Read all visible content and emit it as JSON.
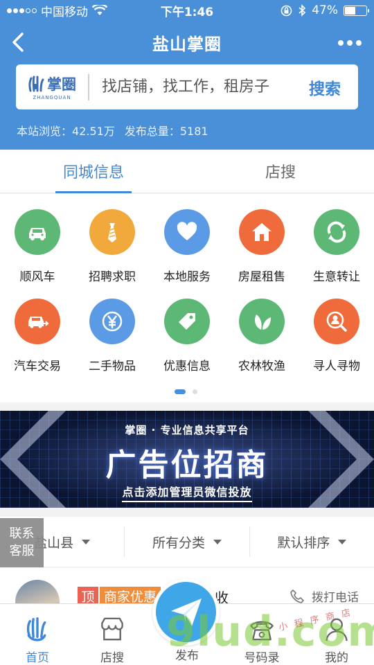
{
  "status_bar": {
    "carrier": "中国移动",
    "time": "下午1:46",
    "battery": "47%",
    "battery_level": 0.47
  },
  "header": {
    "title": "盐山掌圈",
    "logo_text": "掌圈",
    "logo_subtext": "ZHANGQUAN",
    "search_placeholder": "找店铺，找工作，租房子",
    "search_button": "搜索",
    "stats_views_label": "本站浏览：",
    "stats_views": "42.51万",
    "stats_posts_label": "发布总量：",
    "stats_posts": "5181"
  },
  "tabs": [
    {
      "label": "同城信息",
      "active": true
    },
    {
      "label": "店搜",
      "active": false
    }
  ],
  "categories": [
    {
      "label": "顺风车",
      "icon": "car-icon",
      "color": "#5cb874"
    },
    {
      "label": "招聘求职",
      "icon": "tie-icon",
      "color": "#f2a93b"
    },
    {
      "label": "本地服务",
      "icon": "heart-icon",
      "color": "#5b9be6"
    },
    {
      "label": "房屋租售",
      "icon": "house-icon",
      "color": "#ef6b3c"
    },
    {
      "label": "生意转让",
      "icon": "transfer-icon",
      "color": "#5cb874"
    },
    {
      "label": "汽车交易",
      "icon": "car-trade-icon",
      "color": "#ef6b3c"
    },
    {
      "label": "二手物品",
      "icon": "yuan-icon",
      "color": "#5b9be6"
    },
    {
      "label": "优惠信息",
      "icon": "price-tag-icon",
      "color": "#5cb874"
    },
    {
      "label": "农林牧渔",
      "icon": "leaf-icon",
      "color": "#5cb874"
    },
    {
      "label": "寻人寻物",
      "icon": "search-person-icon",
      "color": "#ef6b3c"
    }
  ],
  "pager": {
    "current": 1,
    "total": 2
  },
  "banner": {
    "subtitle": "掌圈 · 专业信息共享平台",
    "headline": "广告位招商",
    "cta": "点击添加管理员微信投放"
  },
  "filters": [
    {
      "label": "盐山县"
    },
    {
      "label": "所有分类"
    },
    {
      "label": "默认排序"
    }
  ],
  "contact": {
    "line1": "联系",
    "line2": "客服"
  },
  "listing": {
    "top_tag": "顶",
    "category_tag": "商家优惠",
    "title_fragment": "收",
    "call_label": "拨打电话"
  },
  "bottom_nav": [
    {
      "label": "首页",
      "icon": "palm-icon",
      "active": true
    },
    {
      "label": "店搜",
      "icon": "store-icon",
      "active": false
    },
    {
      "label": "发布",
      "icon": "paper-plane-icon",
      "active": false
    },
    {
      "label": "号码录",
      "icon": "phone-book-icon",
      "active": false
    },
    {
      "label": "我的",
      "icon": "user-icon",
      "active": false
    }
  ],
  "watermark": {
    "big": "9lud.com",
    "small": "小 程 序 商 店"
  },
  "colors": {
    "brand_blue": "#4a90d9",
    "accent_blue": "#3f87d7",
    "green": "#5cb874",
    "orange": "#ef6b3c",
    "yellow": "#f2a93b"
  }
}
